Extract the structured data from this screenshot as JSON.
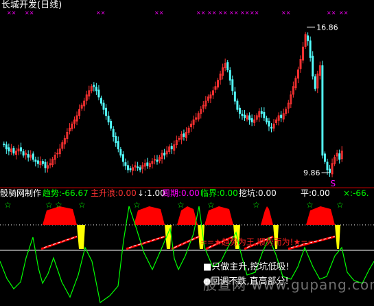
{
  "window": {
    "title": "长城开发(日线)"
  },
  "colors": {
    "up": "#ff3232",
    "down": "#54ffff",
    "green_line": "#00ff00",
    "red_fill": "#ff0000",
    "yellow_fill": "#ffff00",
    "magenta_marks": "#ff00ff",
    "white": "#ffffff"
  },
  "price_panel": {
    "high_label": "16.86",
    "low_label": "9.86",
    "signal_label": "S",
    "top_marks": "×××"
  },
  "indicator_header": {
    "name": "骰骑网制作",
    "items": [
      {
        "text": "趋势:-66.67",
        "color": "#00ff00"
      },
      {
        "text": "主升浪:0.00",
        "color": "#ff3333"
      },
      {
        "text": "↓:1.00",
        "color": "#ffffff"
      },
      {
        "text": "周期:0.00",
        "color": "#ff00ff"
      },
      {
        "text": "临界:0.00",
        "color": "#00ff00"
      },
      {
        "text": "挖坑:0.00",
        "color": "#ffffff"
      },
      {
        "text": "平:0.00",
        "color": "#ffffff"
      },
      {
        "text": "×:-66.",
        "color": "#00ff00"
      }
    ]
  },
  "indicator_panel": {
    "star_mark": "☆",
    "banner": "==★趋势为王,顺势而为!★==",
    "notes": [
      "■只做主升,挖坑低吸!",
      "●回调不跌,直高部分!"
    ],
    "watermark": "股查网 www.gupang.com"
  },
  "chart_data": {
    "type": "candlestick",
    "title": "长城开发(日线)",
    "price_high": 16.86,
    "price_low": 9.86,
    "indicator_values": {
      "趋势": -66.67,
      "主升浪": 0.0,
      "↓": 1.0,
      "周期": 0.0,
      "临界": 0.0,
      "挖坑": 0.0,
      "平": 0.0
    },
    "close_series": [
      11.2,
      11.0,
      10.9,
      11.0,
      10.8,
      10.9,
      11.0,
      10.9,
      10.7,
      10.8,
      10.6,
      10.7,
      10.5,
      10.4,
      10.3,
      10.4,
      10.3,
      10.1,
      10.2,
      10.3,
      10.5,
      10.7,
      10.8,
      11.0,
      11.3,
      11.5,
      11.8,
      12.0,
      12.2,
      12.4,
      12.6,
      12.9,
      13.1,
      13.3,
      13.6,
      13.8,
      14.0,
      14.0,
      13.8,
      13.5,
      13.2,
      12.9,
      12.6,
      12.3,
      12.0,
      11.6,
      11.3,
      11.0,
      10.7,
      10.4,
      10.2,
      10.0,
      10.0,
      10.1,
      10.2,
      10.1,
      10.0,
      10.2,
      10.3,
      10.2,
      10.3,
      10.4,
      10.5,
      10.4,
      10.6,
      10.8,
      10.7,
      10.9,
      11.1,
      11.0,
      11.2,
      11.4,
      11.5,
      11.7,
      11.6,
      11.8,
      12.0,
      12.2,
      12.4,
      12.5,
      12.7,
      12.9,
      13.1,
      13.3,
      13.5,
      13.6,
      13.8,
      14.0,
      14.3,
      14.6,
      14.9,
      15.1,
      14.8,
      14.3,
      13.8,
      13.3,
      12.9,
      12.7,
      12.6,
      12.5,
      12.6,
      12.4,
      12.3,
      12.4,
      12.6,
      12.8,
      12.7,
      12.5,
      12.3,
      12.1,
      12.0,
      12.2,
      12.4,
      12.6,
      12.5,
      12.7,
      12.9,
      13.2,
      13.6,
      14.0,
      14.4,
      14.8,
      15.3,
      15.9,
      16.5,
      16.2,
      15.4,
      14.5,
      13.9,
      14.6,
      15.0,
      10.7,
      10.4,
      10.0,
      9.86,
      10.3,
      10.6,
      10.8,
      10.5,
      10.9
    ]
  }
}
